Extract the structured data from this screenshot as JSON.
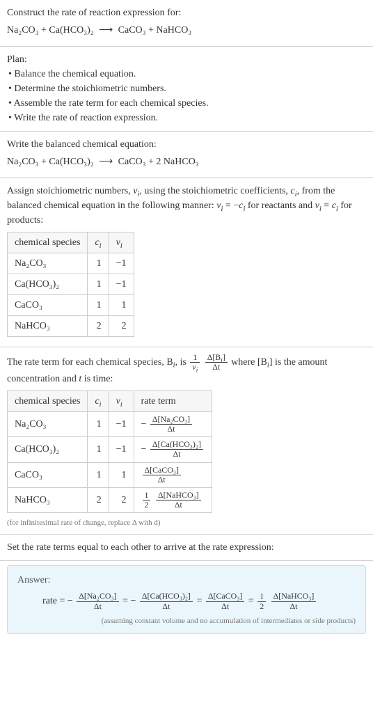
{
  "section1": {
    "prompt": "Construct the rate of reaction expression for:",
    "equation_unbalanced_lhs": "Na₂CO₃ + Ca(HCO₃)₂",
    "equation_unbalanced_rhs": "CaCO₃ + NaHCO₃"
  },
  "section2": {
    "heading": "Plan:",
    "items": [
      "Balance the chemical equation.",
      "Determine the stoichiometric numbers.",
      "Assemble the rate term for each chemical species.",
      "Write the rate of reaction expression."
    ]
  },
  "section3": {
    "heading": "Write the balanced chemical equation:",
    "equation_balanced_lhs": "Na₂CO₃ + Ca(HCO₃)₂",
    "equation_balanced_rhs": "CaCO₃ + 2 NaHCO₃"
  },
  "section4": {
    "text_before": "Assign stoichiometric numbers, ",
    "var_nu": "ν",
    "sub_i": "i",
    "text_mid1": ", using the stoichiometric coefficients, ",
    "var_c": "c",
    "text_mid2": ", from the balanced chemical equation in the following manner: ",
    "rel_reactants_lhs": "ν",
    "rel_reactants_eq": " = −",
    "rel_reactants_rhs": "c",
    "text_for_reactants": " for reactants and ",
    "rel_products_lhs": "ν",
    "rel_products_eq": " = ",
    "rel_products_rhs": "c",
    "text_for_products": " for products:",
    "table_headers": {
      "h1": "chemical species",
      "h2": "c",
      "h3": "ν"
    },
    "rows": [
      {
        "species": "Na₂CO₃",
        "c": "1",
        "nu": "−1"
      },
      {
        "species": "Ca(HCO₃)₂",
        "c": "1",
        "nu": "−1"
      },
      {
        "species": "CaCO₃",
        "c": "1",
        "nu": "1"
      },
      {
        "species": "NaHCO₃",
        "c": "2",
        "nu": "2"
      }
    ]
  },
  "section5": {
    "text_before": "The rate term for each chemical species, B",
    "text_mid1": ", is ",
    "frac1_num": "1",
    "frac1_den_var": "ν",
    "frac2_num": "Δ[B",
    "frac2_num_close": "]",
    "frac2_den": "Δt",
    "text_mid2": " where [B",
    "text_mid3": "] is the amount concentration and ",
    "var_t": "t",
    "text_end": " is time:",
    "table_headers": {
      "h1": "chemical species",
      "h2": "c",
      "h3": "ν",
      "h4": "rate term"
    },
    "rows": [
      {
        "species": "Na₂CO₃",
        "c": "1",
        "nu": "−1",
        "rate_sign": "−",
        "rate_coeff": "",
        "rate_num": "Δ[Na₂CO₃]",
        "rate_den": "Δt"
      },
      {
        "species": "Ca(HCO₃)₂",
        "c": "1",
        "nu": "−1",
        "rate_sign": "−",
        "rate_coeff": "",
        "rate_num": "Δ[Ca(HCO₃)₂]",
        "rate_den": "Δt"
      },
      {
        "species": "CaCO₃",
        "c": "1",
        "nu": "1",
        "rate_sign": "",
        "rate_coeff": "",
        "rate_num": "Δ[CaCO₃]",
        "rate_den": "Δt"
      },
      {
        "species": "NaHCO₃",
        "c": "2",
        "nu": "2",
        "rate_sign": "",
        "rate_coeff_num": "1",
        "rate_coeff_den": "2",
        "rate_num": "Δ[NaHCO₃]",
        "rate_den": "Δt"
      }
    ],
    "footnote": "(for infinitesimal rate of change, replace Δ with d)"
  },
  "section6": {
    "heading": "Set the rate terms equal to each other to arrive at the rate expression:"
  },
  "answer": {
    "label": "Answer:",
    "lead": "rate = ",
    "terms": [
      {
        "sign": "−",
        "coeff_num": "",
        "coeff_den": "",
        "num": "Δ[Na₂CO₃]",
        "den": "Δt"
      },
      {
        "sign": "−",
        "coeff_num": "",
        "coeff_den": "",
        "num": "Δ[Ca(HCO₃)₂]",
        "den": "Δt"
      },
      {
        "sign": "",
        "coeff_num": "",
        "coeff_den": "",
        "num": "Δ[CaCO₃]",
        "den": "Δt"
      },
      {
        "sign": "",
        "coeff_num": "1",
        "coeff_den": "2",
        "num": "Δ[NaHCO₃]",
        "den": "Δt"
      }
    ],
    "eq_sep": " = ",
    "note": "(assuming constant volume and no accumulation of intermediates or side products)"
  }
}
